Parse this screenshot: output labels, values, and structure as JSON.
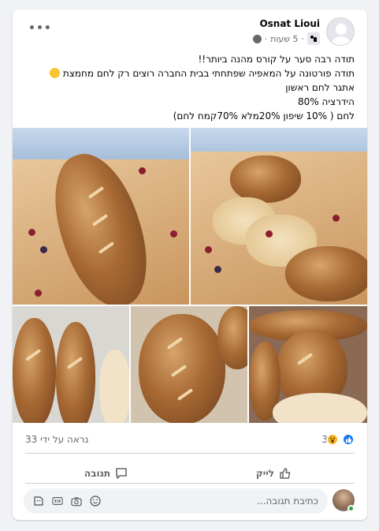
{
  "post": {
    "author": "Osnat Lioui",
    "time": "5 שעות",
    "separator": "·",
    "more_label": "•••",
    "text_lines": [
      "תודה רבה סער על קורס מהנה ביותר!!",
      "תודה פורטונה על המאפיה שפתחתי בבית החברה רוצים רק לחם מחמצת",
      "אתגר לחם ראשון",
      "הידרציה 80%",
      "לחם ( 10% שיפון 20%מלא 70%קמח לחם)"
    ]
  },
  "photos": [
    {
      "name": "photo-baguette-berries-1"
    },
    {
      "name": "photo-sliced-loaf"
    },
    {
      "name": "photo-baguettes-tray"
    },
    {
      "name": "photo-loaf-closeup"
    },
    {
      "name": "photo-loaves-rack"
    }
  ],
  "stats": {
    "reaction_count": "3",
    "seen_by": "נראה על ידי 33"
  },
  "actions": {
    "like_label": "לייק",
    "comment_label": "תגובה"
  },
  "comment": {
    "placeholder": "כתיבת תגובה..."
  },
  "icons": {
    "like": "like-icon",
    "comment": "comment-bubble-icon",
    "wow": "wow-reaction-icon",
    "globe": "globe-icon",
    "emoji": "emoji-icon",
    "camera": "camera-icon",
    "gif": "gif-icon",
    "sticker": "sticker-icon"
  },
  "colors": {
    "accent": "#1877f2",
    "wow": "#f7b125",
    "online": "#31a24c"
  }
}
